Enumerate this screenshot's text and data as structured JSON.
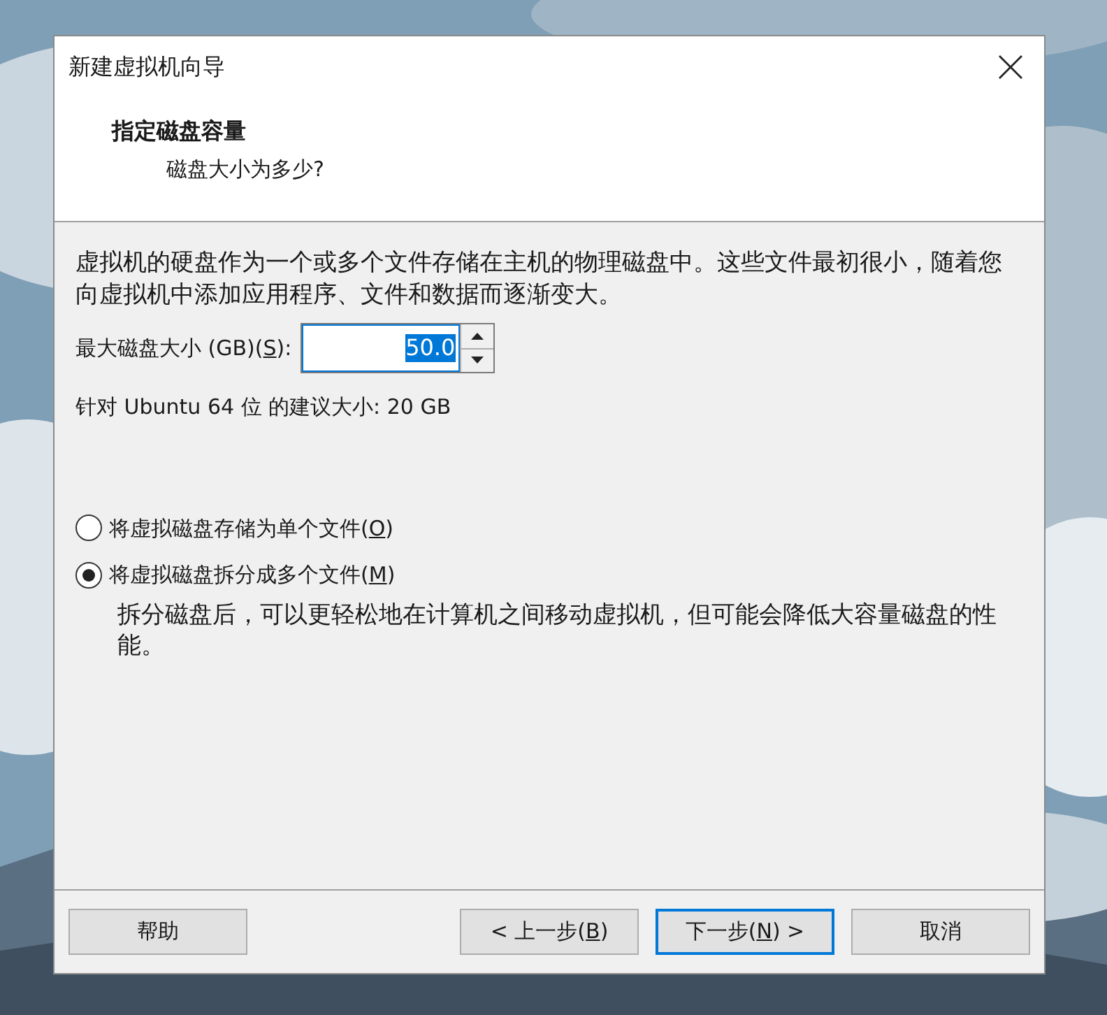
{
  "window": {
    "title": "新建虚拟机向导"
  },
  "header": {
    "title": "指定磁盘容量",
    "subtitle": "磁盘大小为多少?"
  },
  "description": "虚拟机的硬盘作为一个或多个文件存储在主机的物理磁盘中。这些文件最初很小，随着您向虚拟机中添加应用程序、文件和数据而逐渐变大。",
  "disk_size": {
    "label_before": "最大磁盘大小 (GB)(",
    "mnemonic": "S",
    "label_after": "):",
    "value": "50.0"
  },
  "recommendation": "针对 Ubuntu 64 位 的建议大小: 20 GB",
  "options": [
    {
      "label_before": "将虚拟磁盘存储为单个文件(",
      "mnemonic": "O",
      "label_after": ")",
      "selected": false
    },
    {
      "label_before": "将虚拟磁盘拆分成多个文件(",
      "mnemonic": "M",
      "label_after": ")",
      "selected": true
    }
  ],
  "option_note": "拆分磁盘后，可以更轻松地在计算机之间移动虚拟机，但可能会降低大容量磁盘的性能。",
  "buttons": [
    {
      "label_before": "帮助",
      "focused": false
    },
    {
      "label_before": "< 上一步(",
      "mnemonic": "B",
      "label_after": ")",
      "focused": false
    },
    {
      "label_before": "下一步(",
      "mnemonic": "N",
      "label_after": ") >",
      "focused": true
    },
    {
      "label_before": "取消",
      "focused": false
    }
  ]
}
